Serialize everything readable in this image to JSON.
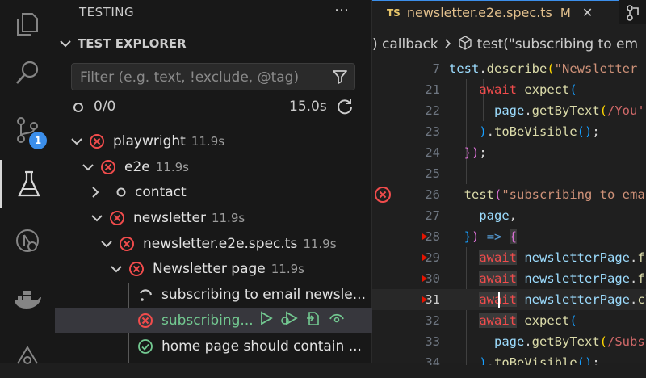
{
  "activity_bar": {
    "badge": "1"
  },
  "sidebar": {
    "title": "TESTING",
    "section_title": "TEST EXPLORER",
    "filter_placeholder": "Filter (e.g. text, !exclude, @tag)",
    "passed_count": "0/0",
    "duration": "15.0s",
    "tree": [
      {
        "label": "playwright",
        "dur": "11.9s"
      },
      {
        "label": "e2e",
        "dur": "11.9s"
      },
      {
        "label": "contact",
        "dur": ""
      },
      {
        "label": "newsletter",
        "dur": "11.9s"
      },
      {
        "label": "newsletter.e2e.spec.ts",
        "dur": "11.9s"
      },
      {
        "label": "Newsletter page",
        "dur": "11.9s"
      },
      {
        "label": "subscribing to email newsle...",
        "dur": ""
      },
      {
        "label": "subscribing...",
        "dur": ""
      },
      {
        "label": "home page should contain ...",
        "dur": ""
      }
    ]
  },
  "editor": {
    "tab": {
      "lang": "TS",
      "name": "newsletter.e2e.spec.ts",
      "status": "M"
    },
    "breadcrumb": {
      "a": ") callback",
      "b": "test(\"subscribing to em"
    },
    "line_numbers": [
      "7",
      "21",
      "22",
      "23",
      "24",
      "25",
      "26",
      "27",
      "28",
      "29",
      "30",
      "31",
      "32",
      "33",
      "34"
    ]
  },
  "colors": {
    "accent": "#3b8eea",
    "error": "#f14c4c",
    "pass": "#73c991"
  }
}
